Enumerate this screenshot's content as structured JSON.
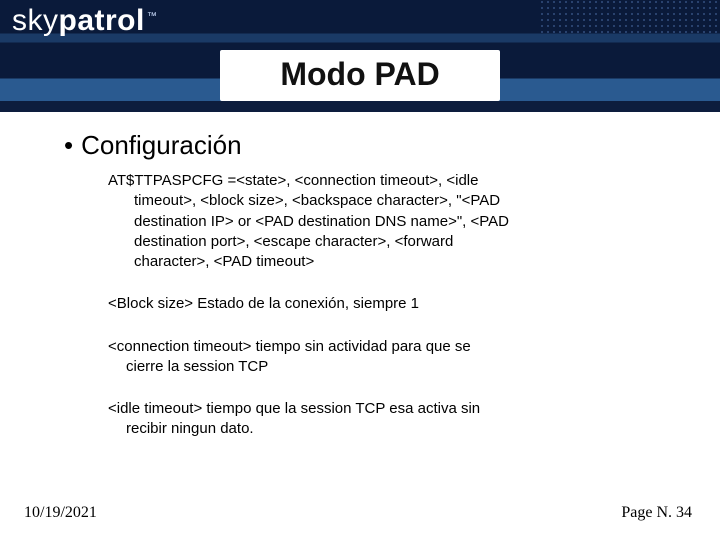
{
  "logo": {
    "part1": "sky",
    "part2": "patrol",
    "tm": "™"
  },
  "title": "Modo PAD",
  "bullet": {
    "glyph": "•",
    "label": "Configuración"
  },
  "cmd": {
    "l1": "AT$TTPASPCFG =<state>, <connection timeout>, <idle",
    "l2": "timeout>, <block size>, <backspace character>, \"<PAD",
    "l3": "destination IP> or <PAD destination DNS name>\", <PAD",
    "l4": "destination port>, <escape character>, <forward",
    "l5": "character>, <PAD timeout>"
  },
  "p1": {
    "l1": "<Block size>  Estado de la conexión, siempre 1"
  },
  "p2": {
    "l1": "<connection timeout> tiempo sin actividad para que se",
    "l2": "cierre la session TCP"
  },
  "p3": {
    "l1": "<idle timeout> tiempo que la session TCP esa activa sin",
    "l2": "recibir ningun dato."
  },
  "footer": {
    "date": "10/19/2021",
    "page": "Page N. 34"
  }
}
